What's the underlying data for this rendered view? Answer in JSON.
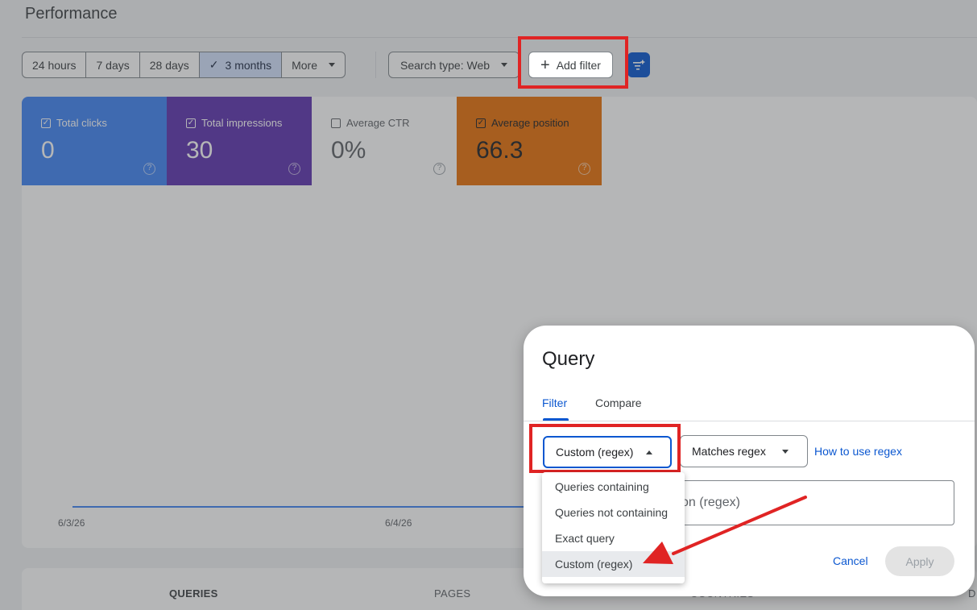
{
  "page": {
    "title": "Performance"
  },
  "date_range": {
    "options": [
      "24 hours",
      "7 days",
      "28 days",
      "3 months",
      "More"
    ],
    "selected": "3 months"
  },
  "toolbar": {
    "search_type": "Search type: Web",
    "add_filter": "Add filter"
  },
  "metrics": [
    {
      "label": "Total clicks",
      "value": "0",
      "checked": true,
      "color": "#4285f4"
    },
    {
      "label": "Total impressions",
      "value": "30",
      "checked": true,
      "color": "#5e35b1"
    },
    {
      "label": "Average CTR",
      "value": "0%",
      "checked": false,
      "color": "#ffffff"
    },
    {
      "label": "Average position",
      "value": "66.3",
      "checked": true,
      "color": "#e8710a"
    }
  ],
  "chart": {
    "x_ticks": [
      "6/3/26",
      "6/4/26"
    ]
  },
  "table_tabs": [
    "QUERIES",
    "PAGES",
    "COUNTRIES",
    "D"
  ],
  "dialog": {
    "title": "Query",
    "tabs": [
      "Filter",
      "Compare"
    ],
    "active_tab": "Filter",
    "filter_type": "Custom (regex)",
    "match_type": "Matches regex",
    "help_link": "How to use regex",
    "input_placeholder": "on (regex)",
    "cancel": "Cancel",
    "apply": "Apply"
  },
  "filter_menu": {
    "items": [
      "Queries containing",
      "Queries not containing",
      "Exact query",
      "Custom (regex)"
    ],
    "highlighted": "Custom (regex)"
  },
  "colors": {
    "accent": "#0b57d0",
    "annotation": "#e02424"
  }
}
